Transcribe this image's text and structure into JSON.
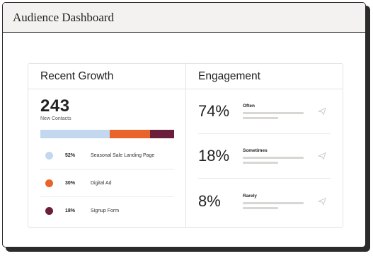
{
  "window": {
    "title": "Audience Dashboard"
  },
  "growth": {
    "heading": "Recent Growth",
    "total": "243",
    "total_label": "New Contacts",
    "segments": [
      {
        "share": 0.52,
        "color": "#c3d8ee"
      },
      {
        "share": 0.3,
        "color": "#e8642a"
      },
      {
        "share": 0.18,
        "color": "#6b1e3c"
      }
    ],
    "items": [
      {
        "percent": "52%",
        "label": "Seasonal Sale Landing Page",
        "color": "#c3d8ee"
      },
      {
        "percent": "30%",
        "label": "Digital Ad",
        "color": "#e8642a"
      },
      {
        "percent": "18%",
        "label": "Signup Form",
        "color": "#6b1e3c"
      }
    ]
  },
  "engagement": {
    "heading": "Engagement",
    "items": [
      {
        "percent": "74%",
        "label": "Often",
        "icon": "send-icon"
      },
      {
        "percent": "18%",
        "label": "Sometimes",
        "icon": "send-icon"
      },
      {
        "percent": "8%",
        "label": "Rarely",
        "icon": "send-icon"
      }
    ]
  }
}
